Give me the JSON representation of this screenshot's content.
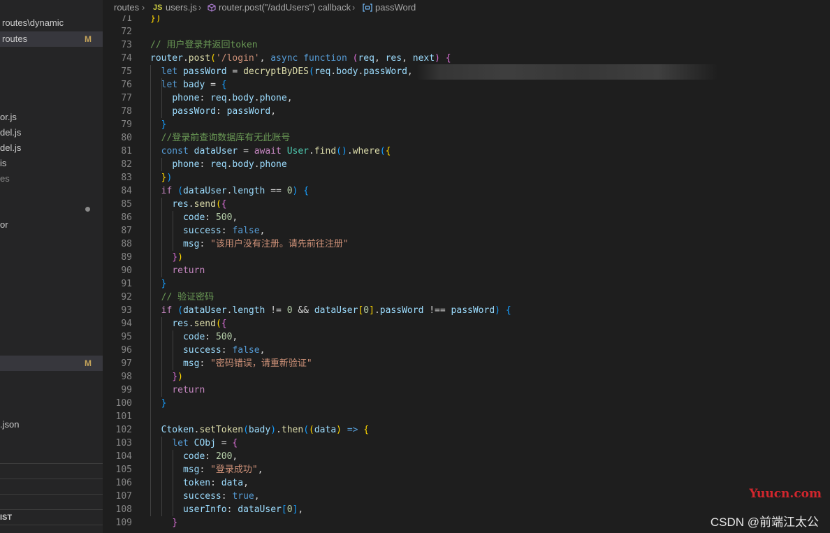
{
  "sidebar": {
    "rows": [
      {
        "text": "routes\\dynamic",
        "badge": "",
        "state": ""
      },
      {
        "text": "routes",
        "badge": "M",
        "state": "sel"
      },
      {
        "text": "or.js",
        "badge": "",
        "state": ""
      },
      {
        "text": "del.js",
        "badge": "",
        "state": ""
      },
      {
        "text": "del.js",
        "badge": "",
        "state": ""
      },
      {
        "text": "is",
        "badge": "",
        "state": ""
      },
      {
        "text": "es",
        "badge": "",
        "state": "dim"
      },
      {
        "text": "or",
        "badge": "",
        "state": ""
      },
      {
        "text": "",
        "badge": "M",
        "state": "sel"
      },
      {
        "text": ".json",
        "badge": "",
        "state": ""
      }
    ],
    "section_label": "IST"
  },
  "breadcrumb": {
    "items": [
      "routes",
      "users.js",
      "router.post(\"/addUsers\") callback",
      "passWord"
    ],
    "js_icon": "JS"
  },
  "editor": {
    "line_numbers": [
      "71",
      "72",
      "73",
      "74",
      "75",
      "76",
      "77",
      "78",
      "79",
      "80",
      "81",
      "82",
      "83",
      "84",
      "85",
      "86",
      "87",
      "88",
      "89",
      "90",
      "91",
      "92",
      "93",
      "94",
      "95",
      "96",
      "97",
      "98",
      "99",
      "100",
      "101",
      "102",
      "103",
      "104",
      "105",
      "106",
      "107",
      "108",
      "109"
    ],
    "lines": [
      [
        [
          "p",
          ""
        ],
        [
          "b1",
          "})"
        ]
      ],
      [],
      [
        [
          "cm",
          "// 用户登录并返回token"
        ]
      ],
      [
        [
          "v",
          "router"
        ],
        [
          "p",
          "."
        ],
        [
          "f",
          "post"
        ],
        [
          "b1",
          "("
        ],
        [
          "s",
          "'/login'"
        ],
        [
          "p",
          ", "
        ],
        [
          "k",
          "async"
        ],
        [
          "p",
          " "
        ],
        [
          "k",
          "function"
        ],
        [
          "p",
          " "
        ],
        [
          "b2",
          "("
        ],
        [
          "v",
          "req"
        ],
        [
          "p",
          ", "
        ],
        [
          "v",
          "res"
        ],
        [
          "p",
          ", "
        ],
        [
          "v",
          "next"
        ],
        [
          "b2",
          ")"
        ],
        [
          "p",
          " "
        ],
        [
          "b2",
          "{"
        ]
      ],
      [
        [
          "p",
          "  "
        ],
        [
          "k",
          "let"
        ],
        [
          "p",
          " "
        ],
        [
          "v",
          "passWord"
        ],
        [
          "p",
          " = "
        ],
        [
          "f",
          "decryptByDES"
        ],
        [
          "b3",
          "("
        ],
        [
          "v",
          "req"
        ],
        [
          "p",
          "."
        ],
        [
          "v",
          "body"
        ],
        [
          "p",
          "."
        ],
        [
          "v",
          "passWord"
        ],
        [
          "p",
          ","
        ]
      ],
      [
        [
          "p",
          "  "
        ],
        [
          "k",
          "let"
        ],
        [
          "p",
          " "
        ],
        [
          "v",
          "bady"
        ],
        [
          "p",
          " = "
        ],
        [
          "b3",
          "{"
        ]
      ],
      [
        [
          "p",
          "    "
        ],
        [
          "v",
          "phone"
        ],
        [
          "p",
          ": "
        ],
        [
          "v",
          "req"
        ],
        [
          "p",
          "."
        ],
        [
          "v",
          "body"
        ],
        [
          "p",
          "."
        ],
        [
          "v",
          "phone"
        ],
        [
          "p",
          ","
        ]
      ],
      [
        [
          "p",
          "    "
        ],
        [
          "v",
          "passWord"
        ],
        [
          "p",
          ": "
        ],
        [
          "v",
          "passWord"
        ],
        [
          "p",
          ","
        ]
      ],
      [
        [
          "p",
          "  "
        ],
        [
          "b3",
          "}"
        ]
      ],
      [
        [
          "p",
          "  "
        ],
        [
          "cm",
          "//登录前查询数据库有无此账号"
        ]
      ],
      [
        [
          "p",
          "  "
        ],
        [
          "k",
          "const"
        ],
        [
          "p",
          " "
        ],
        [
          "v",
          "dataUser"
        ],
        [
          "p",
          " = "
        ],
        [
          "kc",
          "await"
        ],
        [
          "p",
          " "
        ],
        [
          "c",
          "User"
        ],
        [
          "p",
          "."
        ],
        [
          "f",
          "find"
        ],
        [
          "b3",
          "()"
        ],
        [
          "p",
          "."
        ],
        [
          "f",
          "where"
        ],
        [
          "b3",
          "("
        ],
        [
          "b1",
          "{"
        ]
      ],
      [
        [
          "p",
          "    "
        ],
        [
          "v",
          "phone"
        ],
        [
          "p",
          ": "
        ],
        [
          "v",
          "req"
        ],
        [
          "p",
          "."
        ],
        [
          "v",
          "body"
        ],
        [
          "p",
          "."
        ],
        [
          "v",
          "phone"
        ]
      ],
      [
        [
          "p",
          "  "
        ],
        [
          "b1",
          "}"
        ],
        [
          "b3",
          ")"
        ]
      ],
      [
        [
          "p",
          "  "
        ],
        [
          "kc",
          "if"
        ],
        [
          "p",
          " "
        ],
        [
          "b3",
          "("
        ],
        [
          "v",
          "dataUser"
        ],
        [
          "p",
          "."
        ],
        [
          "v",
          "length"
        ],
        [
          "p",
          " == "
        ],
        [
          "n",
          "0"
        ],
        [
          "b3",
          ")"
        ],
        [
          "p",
          " "
        ],
        [
          "b3",
          "{"
        ]
      ],
      [
        [
          "p",
          "    "
        ],
        [
          "v",
          "res"
        ],
        [
          "p",
          "."
        ],
        [
          "f",
          "send"
        ],
        [
          "b1",
          "("
        ],
        [
          "b2",
          "{"
        ]
      ],
      [
        [
          "p",
          "      "
        ],
        [
          "v",
          "code"
        ],
        [
          "p",
          ": "
        ],
        [
          "n",
          "500"
        ],
        [
          "p",
          ","
        ]
      ],
      [
        [
          "p",
          "      "
        ],
        [
          "v",
          "success"
        ],
        [
          "p",
          ": "
        ],
        [
          "k",
          "false"
        ],
        [
          "p",
          ","
        ]
      ],
      [
        [
          "p",
          "      "
        ],
        [
          "v",
          "msg"
        ],
        [
          "p",
          ": "
        ],
        [
          "s",
          "\"该用户没有注册。请先前往注册\""
        ]
      ],
      [
        [
          "p",
          "    "
        ],
        [
          "b2",
          "}"
        ],
        [
          "b1",
          ")"
        ]
      ],
      [
        [
          "p",
          "    "
        ],
        [
          "kc",
          "return"
        ]
      ],
      [
        [
          "p",
          "  "
        ],
        [
          "b3",
          "}"
        ]
      ],
      [
        [
          "p",
          "  "
        ],
        [
          "cm",
          "// 验证密码"
        ]
      ],
      [
        [
          "p",
          "  "
        ],
        [
          "kc",
          "if"
        ],
        [
          "p",
          " "
        ],
        [
          "b3",
          "("
        ],
        [
          "v",
          "dataUser"
        ],
        [
          "p",
          "."
        ],
        [
          "v",
          "length"
        ],
        [
          "p",
          " != "
        ],
        [
          "n",
          "0"
        ],
        [
          "p",
          " && "
        ],
        [
          "v",
          "dataUser"
        ],
        [
          "b1",
          "["
        ],
        [
          "n",
          "0"
        ],
        [
          "b1",
          "]"
        ],
        [
          "p",
          "."
        ],
        [
          "v",
          "passWord"
        ],
        [
          "p",
          " !== "
        ],
        [
          "v",
          "passWord"
        ],
        [
          "b3",
          ")"
        ],
        [
          "p",
          " "
        ],
        [
          "b3",
          "{"
        ]
      ],
      [
        [
          "p",
          "    "
        ],
        [
          "v",
          "res"
        ],
        [
          "p",
          "."
        ],
        [
          "f",
          "send"
        ],
        [
          "b1",
          "("
        ],
        [
          "b2",
          "{"
        ]
      ],
      [
        [
          "p",
          "      "
        ],
        [
          "v",
          "code"
        ],
        [
          "p",
          ": "
        ],
        [
          "n",
          "500"
        ],
        [
          "p",
          ","
        ]
      ],
      [
        [
          "p",
          "      "
        ],
        [
          "v",
          "success"
        ],
        [
          "p",
          ": "
        ],
        [
          "k",
          "false"
        ],
        [
          "p",
          ","
        ]
      ],
      [
        [
          "p",
          "      "
        ],
        [
          "v",
          "msg"
        ],
        [
          "p",
          ": "
        ],
        [
          "s",
          "\"密码错误，请重新验证\""
        ]
      ],
      [
        [
          "p",
          "    "
        ],
        [
          "b2",
          "}"
        ],
        [
          "b1",
          ")"
        ]
      ],
      [
        [
          "p",
          "    "
        ],
        [
          "kc",
          "return"
        ]
      ],
      [
        [
          "p",
          "  "
        ],
        [
          "b3",
          "}"
        ]
      ],
      [],
      [
        [
          "p",
          "  "
        ],
        [
          "v",
          "Ctoken"
        ],
        [
          "p",
          "."
        ],
        [
          "f",
          "setToken"
        ],
        [
          "b3",
          "("
        ],
        [
          "v",
          "bady"
        ],
        [
          "b3",
          ")"
        ],
        [
          "p",
          "."
        ],
        [
          "f",
          "then"
        ],
        [
          "b3",
          "("
        ],
        [
          "b1",
          "("
        ],
        [
          "v",
          "data"
        ],
        [
          "b1",
          ")"
        ],
        [
          "p",
          " "
        ],
        [
          "k",
          "=>"
        ],
        [
          "p",
          " "
        ],
        [
          "b1",
          "{"
        ]
      ],
      [
        [
          "p",
          "    "
        ],
        [
          "k",
          "let"
        ],
        [
          "p",
          " "
        ],
        [
          "v",
          "CObj"
        ],
        [
          "p",
          " = "
        ],
        [
          "b2",
          "{"
        ]
      ],
      [
        [
          "p",
          "      "
        ],
        [
          "v",
          "code"
        ],
        [
          "p",
          ": "
        ],
        [
          "n",
          "200"
        ],
        [
          "p",
          ","
        ]
      ],
      [
        [
          "p",
          "      "
        ],
        [
          "v",
          "msg"
        ],
        [
          "p",
          ": "
        ],
        [
          "s",
          "\"登录成功\""
        ],
        [
          "p",
          ","
        ]
      ],
      [
        [
          "p",
          "      "
        ],
        [
          "v",
          "token"
        ],
        [
          "p",
          ": "
        ],
        [
          "v",
          "data"
        ],
        [
          "p",
          ","
        ]
      ],
      [
        [
          "p",
          "      "
        ],
        [
          "v",
          "success"
        ],
        [
          "p",
          ": "
        ],
        [
          "k",
          "true"
        ],
        [
          "p",
          ","
        ]
      ],
      [
        [
          "p",
          "      "
        ],
        [
          "v",
          "userInfo"
        ],
        [
          "p",
          ": "
        ],
        [
          "v",
          "dataUser"
        ],
        [
          "b3",
          "["
        ],
        [
          "n",
          "0"
        ],
        [
          "b3",
          "]"
        ],
        [
          "p",
          ","
        ]
      ],
      [
        [
          "p",
          "    "
        ],
        [
          "b2",
          "}"
        ]
      ]
    ]
  },
  "watermarks": {
    "yuucn": "Yuucn.com",
    "csdn": "CSDN @前端江太公"
  }
}
